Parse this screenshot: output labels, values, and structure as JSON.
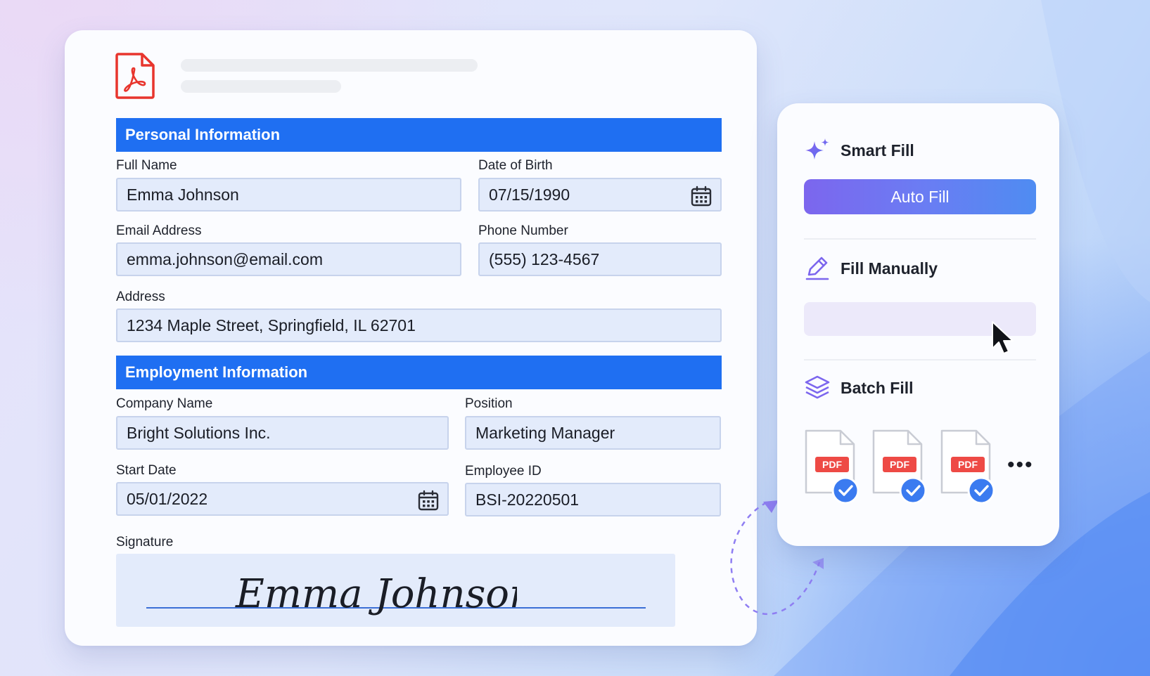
{
  "form": {
    "personal_header": "Personal Information",
    "employment_header": "Employment Information",
    "fields": {
      "full_name": {
        "label": "Full Name",
        "value": "Emma Johnson"
      },
      "dob": {
        "label": "Date of Birth",
        "value": "07/15/1990"
      },
      "email": {
        "label": "Email Address",
        "value": "emma.johnson@email.com"
      },
      "phone": {
        "label": "Phone Number",
        "value": "(555) 123-4567"
      },
      "address": {
        "label": "Address",
        "value": "1234 Maple Street, Springfield, IL 62701"
      },
      "company": {
        "label": "Company Name",
        "value": "Bright Solutions Inc."
      },
      "position": {
        "label": "Position",
        "value": "Marketing Manager"
      },
      "start_date": {
        "label": "Start Date",
        "value": "05/01/2022"
      },
      "employee_id": {
        "label": "Employee ID",
        "value": "BSI-20220501"
      },
      "signature": {
        "label": "Signature",
        "value": "Emma Johnson"
      }
    }
  },
  "panel": {
    "smart_fill": {
      "title": "Smart Fill",
      "button": "Auto Fill"
    },
    "fill_manually": {
      "title": "Fill Manually"
    },
    "batch_fill": {
      "title": "Batch Fill",
      "badge": "PDF",
      "more": "•••"
    }
  },
  "icons": {
    "pdf_logo": "pdf-file-icon",
    "calendar": "calendar-icon",
    "smart_fill": "sparkle-icon",
    "fill_manually": "pencil-icon",
    "batch_fill": "layers-icon",
    "check": "check-circle-icon",
    "cursor": "mouse-pointer-icon"
  },
  "colors": {
    "section_header": "#1f6ff2",
    "field_bg": "#e3ebfb",
    "pdf_red": "#e8352d",
    "accent_purple": "#7c66ee",
    "check_blue": "#3b7bf0"
  }
}
